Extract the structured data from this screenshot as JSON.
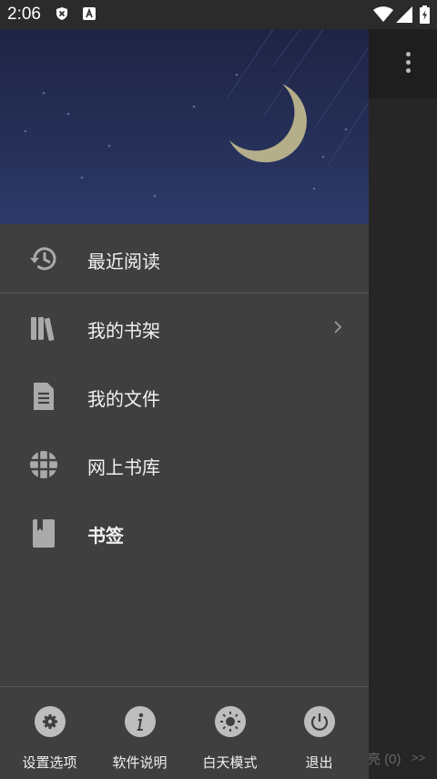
{
  "status_bar": {
    "time": "2:06"
  },
  "drawer": {
    "menu_items": [
      {
        "label": "最近阅读",
        "icon": "history-icon"
      },
      {
        "label": "我的书架",
        "icon": "bookshelf-icon"
      },
      {
        "label": "我的文件",
        "icon": "document-icon"
      },
      {
        "label": "网上书库",
        "icon": "globe-icon"
      },
      {
        "label": "书签",
        "icon": "bookmark-icon"
      }
    ],
    "footer": [
      {
        "label": "设置选项",
        "icon": "gear-icon"
      },
      {
        "label": "软件说明",
        "icon": "info-icon"
      },
      {
        "label": "白天模式",
        "icon": "sun-icon"
      },
      {
        "label": "退出",
        "icon": "power-icon"
      }
    ]
  },
  "background": {
    "status_text": "亮 (0)",
    "next_text": ">>"
  }
}
